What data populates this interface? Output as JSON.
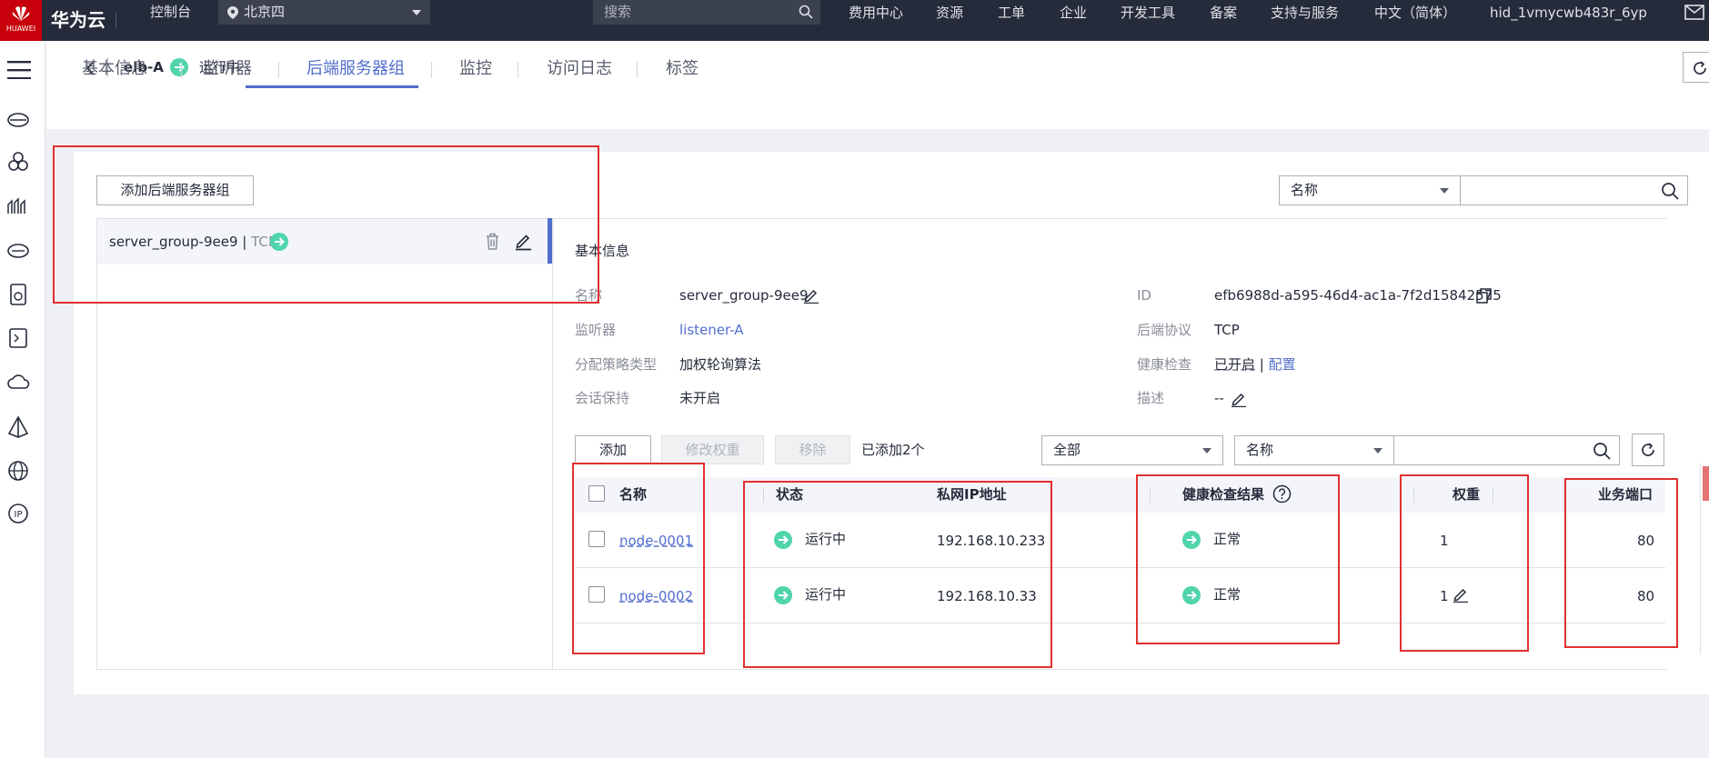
{
  "topbar": {
    "logo_text": "HUAWEI",
    "brand": "华为云",
    "console": "控制台",
    "region": "北京四",
    "search_placeholder": "搜索",
    "menu": [
      "费用中心",
      "资源",
      "工单",
      "企业",
      "开发工具",
      "备案",
      "支持与服务",
      "中文（简体）",
      "hid_1vmycwb483r_6yp"
    ]
  },
  "header": {
    "elb_name": "elb-A",
    "elb_status": "运行中"
  },
  "tabs": [
    "基本信息",
    "监听器",
    "后端服务器组",
    "监控",
    "访问日志",
    "标签"
  ],
  "active_tab": "后端服务器组",
  "toolbar": {
    "add_group_label": "添加后端服务器组",
    "search_field_select": "名称"
  },
  "group": {
    "name": "server_group-9ee9",
    "separator": " | ",
    "protocol": "TCP"
  },
  "basic": {
    "section_title": "基本信息",
    "name_label": "名称",
    "name_value": "server_group-9ee9",
    "listener_label": "监听器",
    "listener_value": "listener-A",
    "algo_label": "分配策略类型",
    "algo_value": "加权轮询算法",
    "session_label": "会话保持",
    "session_value": "未开启",
    "id_label": "ID",
    "id_value": "efb6988d-a595-46d4-ac1a-7f2d15842575",
    "proto_label": "后端协议",
    "proto_value": "TCP",
    "health_label": "健康检查",
    "health_value": "已开启",
    "health_sep": " | ",
    "health_config": "配置",
    "desc_label": "描述",
    "desc_value": "--"
  },
  "members_toolbar": {
    "add": "添加",
    "modify_weight": "修改权重",
    "remove": "移除",
    "added_count": "已添加2个",
    "filter_all": "全部",
    "search_field": "名称"
  },
  "table": {
    "columns": [
      "名称",
      "状态",
      "私网IP地址",
      "健康检查结果",
      "权重",
      "业务端口"
    ],
    "rows": [
      {
        "name": "node-0001",
        "status": "运行中",
        "ip": "192.168.10.233",
        "health": "正常",
        "weight": "1",
        "port": "80"
      },
      {
        "name": "node-0002",
        "status": "运行中",
        "ip": "192.168.10.33",
        "health": "正常",
        "weight": "1",
        "port": "80"
      }
    ]
  },
  "colors": {
    "topbar_bg": "#252b3a",
    "accent": "#526ecc",
    "status_green": "#50d4ab",
    "annotation_red": "#e03030"
  }
}
